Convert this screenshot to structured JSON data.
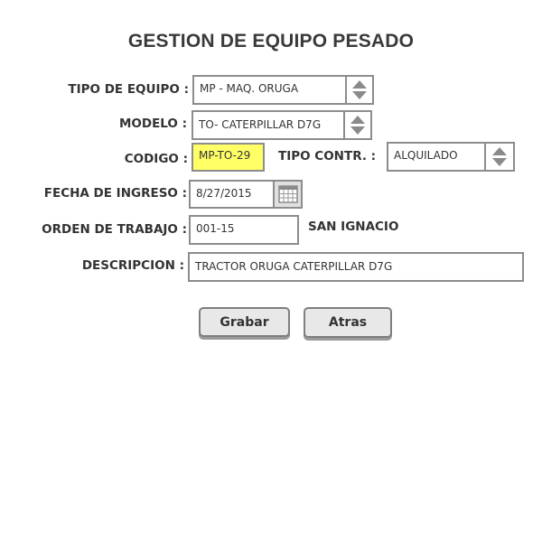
{
  "page": {
    "title": "GESTION DE EQUIPO PESADO"
  },
  "form": {
    "tipo_equipo": {
      "label": "TIPO DE EQUIPO :",
      "value": "MP - MAQ. ORUGA"
    },
    "modelo": {
      "label": "MODELO :",
      "value": "TO- CATERPILLAR D7G"
    },
    "codigo": {
      "label": "CODIGO :",
      "value": "MP-TO-29"
    },
    "tipo_contr": {
      "label": "TIPO CONTR. :",
      "value": "ALQUILADO"
    },
    "fecha_ingreso": {
      "label": "FECHA DE INGRESO :",
      "value": "8/27/2015"
    },
    "orden_trabajo": {
      "label": "ORDEN DE TRABAJO :",
      "value": "001-15",
      "location": "SAN IGNACIO"
    },
    "descripcion": {
      "label": "DESCRIPCION :",
      "value": "TRACTOR ORUGA CATERPILLAR D7G"
    }
  },
  "buttons": {
    "save": "Grabar",
    "back": "Atras"
  },
  "colors": {
    "codigo_highlight": "#ffff66",
    "border": "#8c8c8c",
    "button_bg": "#e8e8e8"
  },
  "icons": {
    "spinner": "up-down-arrows-icon",
    "calendar": "calendar-icon"
  }
}
